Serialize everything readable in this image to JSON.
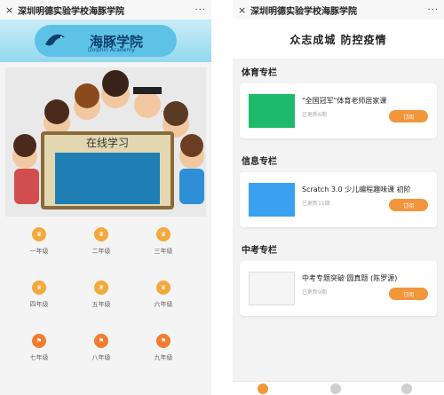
{
  "left": {
    "topbar": {
      "title": "深圳明德实验学校海豚学院",
      "close_label": "×",
      "more_label": "···"
    },
    "banner": {
      "logo_cn": "海豚学院",
      "logo_en": "Dolphin Academy"
    },
    "hero": {
      "board_title": "在线学习"
    },
    "grades": [
      {
        "label": "一年级",
        "style": "yellow"
      },
      {
        "label": "二年级",
        "style": "yellow"
      },
      {
        "label": "三年级",
        "style": "yellow"
      },
      {
        "label": "四年级",
        "style": "yellow"
      },
      {
        "label": "五年级",
        "style": "yellow"
      },
      {
        "label": "六年级",
        "style": "yellow"
      },
      {
        "label": "七年级",
        "style": "orange"
      },
      {
        "label": "八年级",
        "style": "orange"
      },
      {
        "label": "九年级",
        "style": "orange"
      }
    ]
  },
  "right": {
    "topbar": {
      "title": "深圳明德实验学校海豚学院",
      "close_label": "×",
      "more_label": "···"
    },
    "slogan": "众志成城   防控疫情",
    "sections": [
      {
        "title": "体育专栏",
        "card": {
          "title": "\"全国冠军\"体育老师居家课",
          "meta": "已更新6期",
          "button": "订阅"
        }
      },
      {
        "title": "信息专栏",
        "card": {
          "title": "Scratch 3.0 少儿编程趣味课 初阶",
          "meta": "已更新11期",
          "button": "订阅"
        }
      },
      {
        "title": "中考专栏",
        "card": {
          "title": "中考专题突破·圆真题 (陈罗源)",
          "meta": "已更新9期",
          "button": "订阅"
        }
      }
    ]
  }
}
